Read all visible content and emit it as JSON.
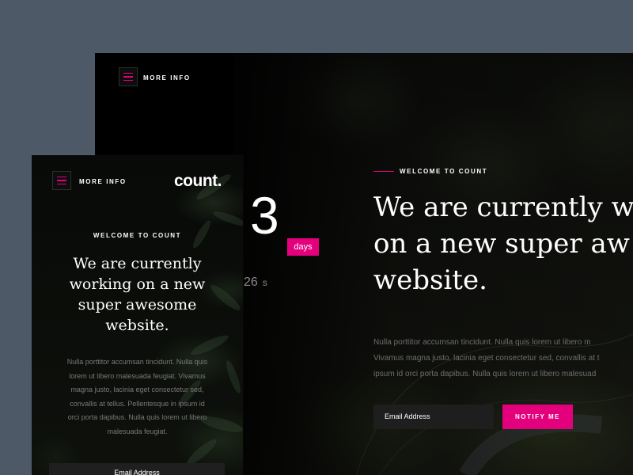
{
  "desktop": {
    "menu_label": "MORE INFO",
    "welcome": "WELCOME TO COUNT",
    "heading_lines": [
      "We are currently w",
      "on a new super aw",
      "website."
    ],
    "body_lines": [
      "Nulla porttitor accumsan tincidunt. Nulla quis lorem ut libero m",
      "Vivamus magna justo, lacinia eget consectetur sed, convallis at t",
      "ipsum id orci porta dapibus. Nulla quis lorem ut libero malesuad"
    ],
    "countdown_number": "3",
    "countdown_unit": "days",
    "seconds_number": "26",
    "seconds_unit": "s",
    "email_placeholder": "Email Address",
    "notify_label": "NOTIFY ME"
  },
  "mobile": {
    "menu_label": "MORE INFO",
    "logo": "count.",
    "welcome": "WELCOME TO COUNT",
    "heading_lines": [
      "We are currently",
      "working on a new",
      "super awesome",
      "website."
    ],
    "body_lines": [
      "Nulla porttitor accumsan tincidunt. Nulla quis",
      "lorem ut libero malesuada feugiat. Vivamus",
      "magna justo, lacinia eget consectetur sed,",
      "convallis at tellus. Pellentesque in ipsum id",
      "orci porta dapibus. Nulla quis lorem ut libero",
      "malesuada feugiat."
    ],
    "email_placeholder": "Email Address"
  },
  "colors": {
    "page_background": "#4e5968",
    "accent": "#e4007d",
    "panel_dark": "#060606"
  },
  "icons": [
    "hamburger-menu-icon"
  ]
}
